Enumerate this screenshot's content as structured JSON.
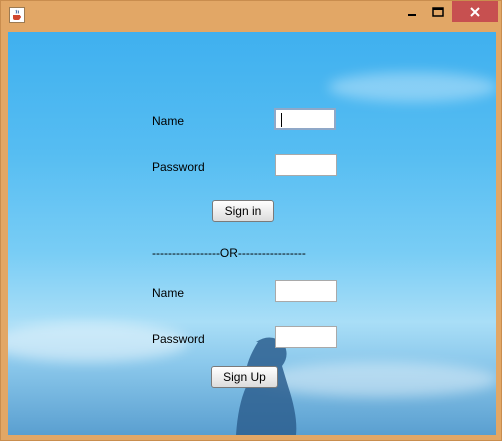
{
  "window": {
    "icon": "java-cup-icon",
    "controls": {
      "minimize": "minimize-icon",
      "maximize": "maximize-icon",
      "close": "close-icon"
    }
  },
  "form": {
    "signin": {
      "name_label": "Name",
      "name_value": "",
      "password_label": "Password",
      "password_value": "",
      "button_label": "Sign in"
    },
    "separator": "-----------------OR-----------------",
    "signup": {
      "name_label": "Name",
      "name_value": "",
      "password_label": "Password",
      "password_value": "",
      "button_label": "Sign Up"
    }
  },
  "colors": {
    "frame": "#e2a766",
    "close_button": "#c75050",
    "sky_top": "#3fb0ef",
    "sky_bottom": "#5a9fd0"
  }
}
